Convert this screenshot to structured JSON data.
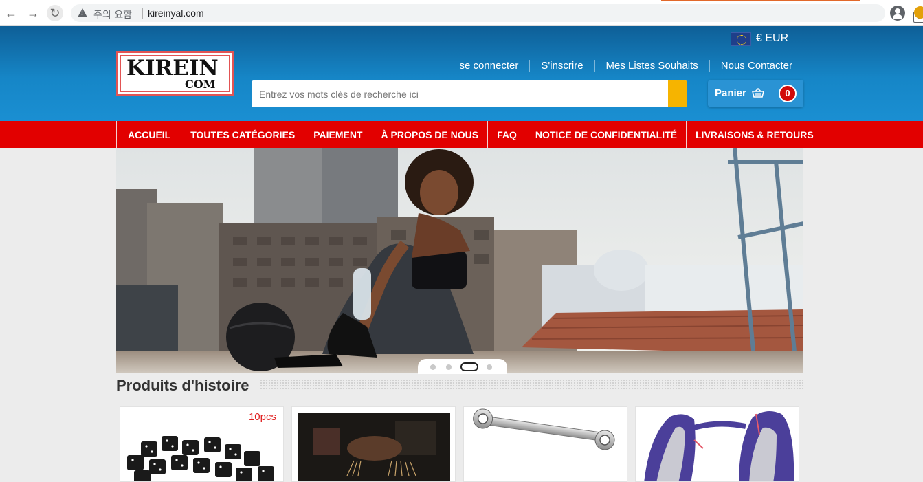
{
  "browser": {
    "security_label": "주의 요함",
    "url": "kireinyal.com"
  },
  "header": {
    "currency": "€ EUR ",
    "logo_main": "KIREIN",
    "logo_sub": "COM",
    "links": [
      "se connecter",
      "S'inscrire",
      "Mes Listes Souhaits",
      "Nous Contacter"
    ],
    "search_placeholder": "Entrez vos mots clés de recherche ici",
    "search_button_icon": "",
    "cart_label": "Panier",
    "cart_count": "0"
  },
  "nav": {
    "items": [
      " ACCUEIL",
      "TOUTES CATÉGORIES ",
      "PAIEMENT",
      "À PROPOS DE NOUS",
      "FAQ",
      "NOTICE DE CONFIDENTIALITÉ",
      "LIVRAISONS & RETOURS"
    ]
  },
  "slider": {
    "slide_count": 4,
    "active_slide": 3
  },
  "products": {
    "title": "Produits d'histoire",
    "cards": [
      {
        "badge": "10pcs"
      },
      {
        "badge": ""
      },
      {
        "badge": ""
      },
      {
        "badge": ""
      }
    ]
  },
  "colors": {
    "header_blue": "#1686c7",
    "nav_red": "#e20000",
    "search_yellow": "#f6b400",
    "cart_badge_red": "#d10a0a"
  }
}
